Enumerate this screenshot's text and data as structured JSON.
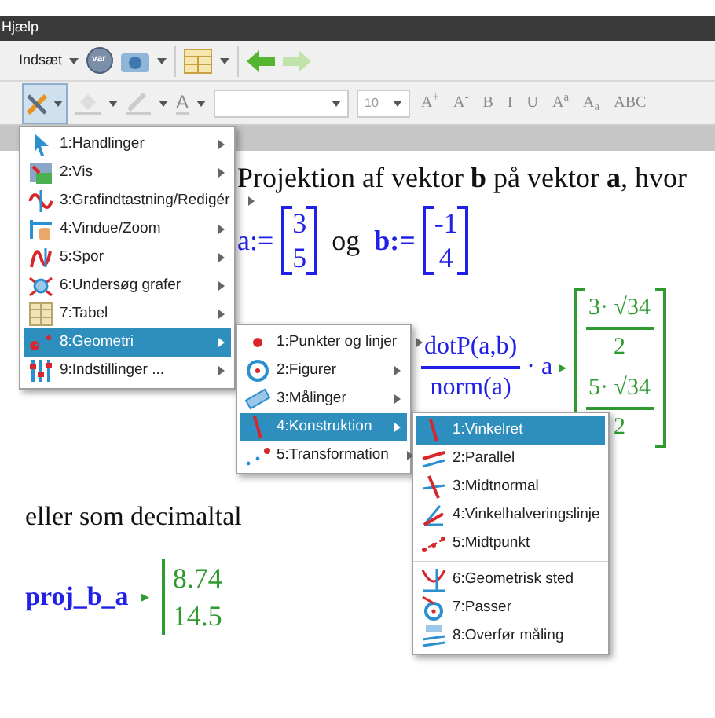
{
  "window": {
    "title": "Hjælp"
  },
  "toolbar": {
    "insert_label": "Indsæt",
    "var_label": "var"
  },
  "format_bar": {
    "text_color_label": "A",
    "font_size": "10",
    "buttons": [
      {
        "label": "A$^{+}$",
        "disabled": true
      },
      {
        "label": "A$^{-}$",
        "disabled": true
      },
      {
        "label": "B",
        "disabled": true
      },
      {
        "label": "I",
        "disabled": true
      },
      {
        "label": "U",
        "disabled": true
      },
      {
        "label": "A$^{a}$",
        "disabled": true
      },
      {
        "label": "A$_{a}$",
        "disabled": true
      },
      {
        "label": "ABC",
        "disabled": true
      }
    ]
  },
  "document": {
    "heading": "Projektion af vektor **b** på vektor **a**, hvor",
    "def_a": "a:=",
    "matrix_a": [
      "3",
      "5"
    ],
    "og": "og",
    "def_b": "b:=",
    "matrix_b": [
      "-1",
      "4"
    ],
    "fraction": {
      "numerator": "dotP(a,b)",
      "denominator": "norm(a)"
    },
    "times_a": "· a",
    "arrow": "▸",
    "result": [
      {
        "numerator": "3· √34",
        "denominator": "2"
      },
      {
        "numerator": "5· √34",
        "denominator": "2"
      }
    ],
    "decimal_text": "eller som decimaltal",
    "proj_name": "proj_b_a",
    "proj_arrow": "▸",
    "proj_values": [
      "8.74",
      "14.5"
    ]
  },
  "menus": [
    {
      "submenu_arrows": true,
      "items": [
        {
          "label": "1:Handlinger",
          "selected": false
        },
        {
          "label": "2:Vis",
          "selected": false
        },
        {
          "label": "3:Grafindtastning/Redigér",
          "selected": false
        },
        {
          "label": "4:Vindue/Zoom",
          "selected": false
        },
        {
          "label": "5:Spor",
          "selected": false
        },
        {
          "label": "6:Undersøg grafer",
          "selected": false
        },
        {
          "label": "7:Tabel",
          "selected": false
        },
        {
          "label": "8:Geometri",
          "selected": true
        },
        {
          "label": "9:Indstillinger ...",
          "selected": false
        }
      ]
    },
    {
      "submenu_arrows": true,
      "items": [
        {
          "label": "1:Punkter og linjer",
          "selected": false
        },
        {
          "label": "2:Figurer",
          "selected": false
        },
        {
          "label": "3:Målinger",
          "selected": false
        },
        {
          "label": "4:Konstruktion",
          "selected": true
        },
        {
          "label": "5:Transformation",
          "selected": false
        }
      ]
    },
    {
      "submenu_arrows": false,
      "items": [
        {
          "label": "1:Vinkelret",
          "selected": true,
          "separator_before": false
        },
        {
          "label": "2:Parallel",
          "selected": false,
          "separator_before": false
        },
        {
          "label": "3:Midtnormal",
          "selected": false,
          "separator_before": false
        },
        {
          "label": "4:Vinkelhalveringslinje",
          "selected": false,
          "separator_before": false
        },
        {
          "label": "5:Midtpunkt",
          "selected": false,
          "separator_before": false
        },
        {
          "label": "6:Geometrisk sted",
          "selected": false,
          "separator_before": true
        },
        {
          "label": "7:Passer",
          "selected": false,
          "separator_before": false
        },
        {
          "label": "8:Overfør måling",
          "selected": false,
          "separator_before": false
        }
      ]
    }
  ]
}
